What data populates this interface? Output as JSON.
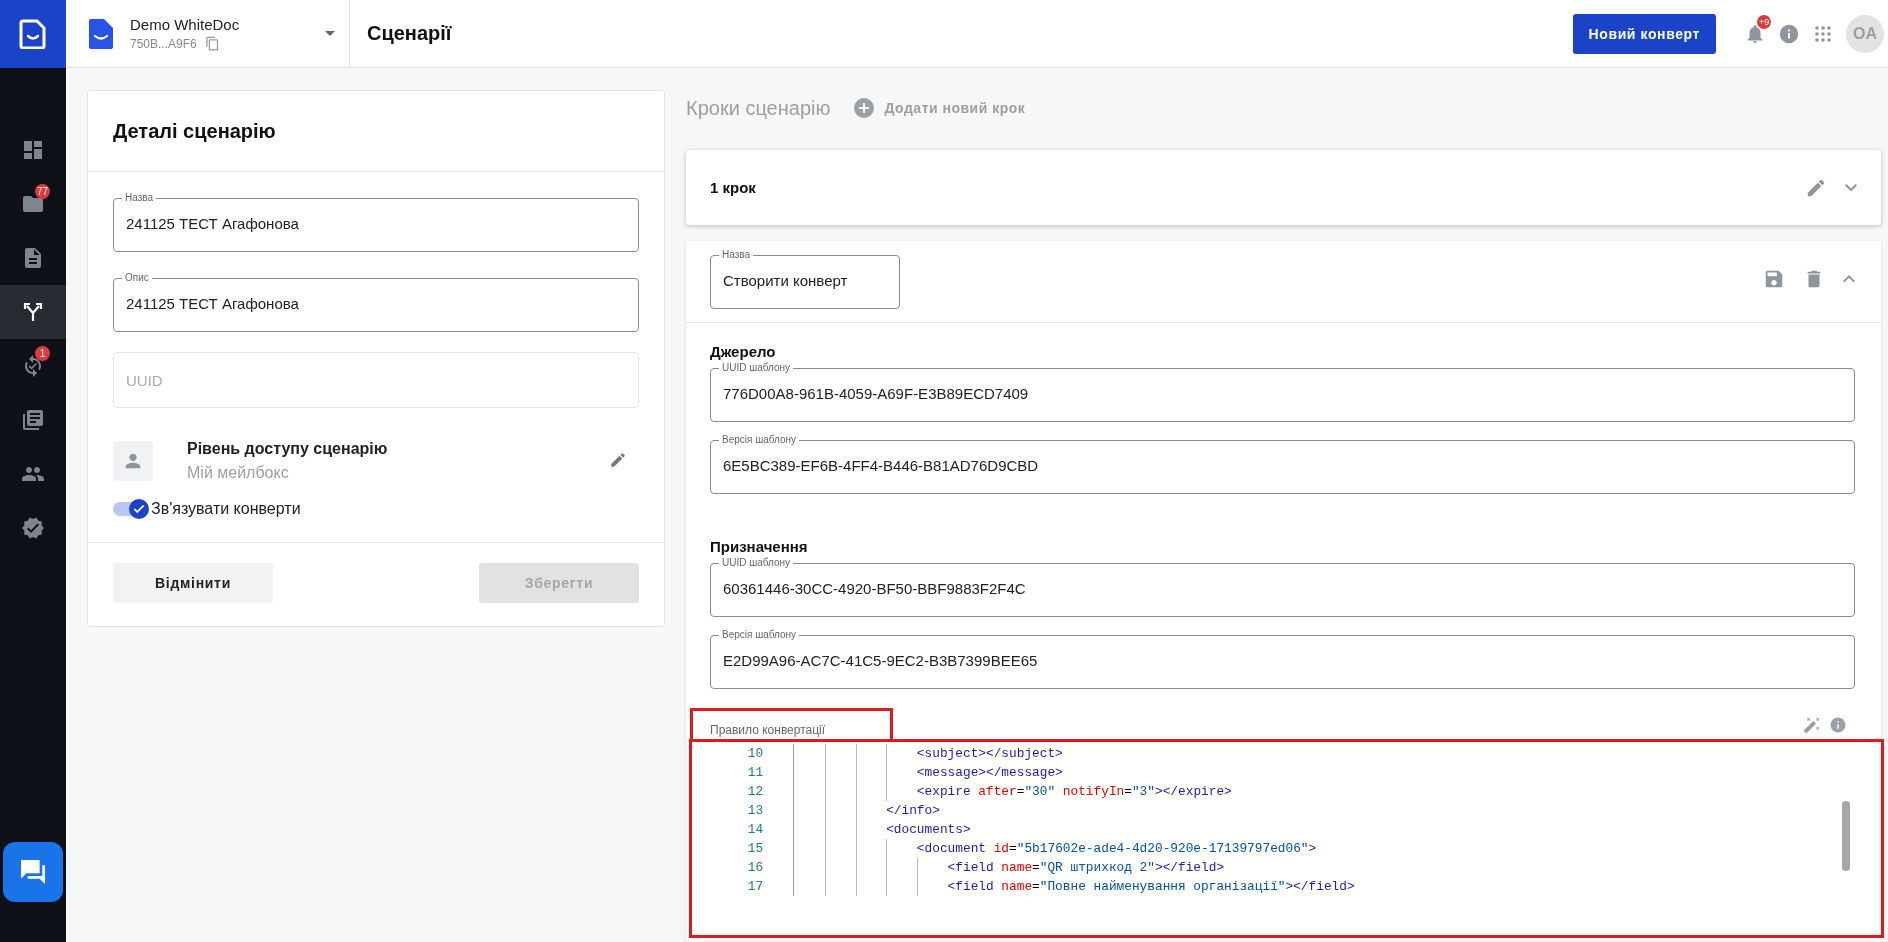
{
  "sidebar": {
    "items": [
      {
        "selected": false
      },
      {
        "selected": false,
        "badge": "77"
      },
      {
        "selected": false
      },
      {
        "selected": true
      },
      {
        "selected": false,
        "badge": "1"
      },
      {
        "selected": false
      },
      {
        "selected": false
      },
      {
        "selected": false
      }
    ]
  },
  "workspace": {
    "name": "Demo WhiteDoc",
    "id": "750B...A9F6"
  },
  "page_title": "Сценарії",
  "header": {
    "new_button": "Новий конверт",
    "notifications_badge": "+9",
    "avatar": "OA"
  },
  "details": {
    "title": "Деталі сценарію",
    "fields": [
      {
        "label": "Назва",
        "value": "241125 ТЕСТ Агафонова"
      },
      {
        "label": "Опис",
        "value": "241125 ТЕСТ Агафонова"
      },
      {
        "placeholder": "UUID"
      }
    ],
    "access": {
      "title": "Рівень доступу сценарію",
      "value": "Мій мейлбокс"
    },
    "link_toggle": {
      "label": "Зв'язувати конверти",
      "on": true
    },
    "buttons": [
      {
        "label": "Відмінити",
        "disabled": false
      },
      {
        "label": "Зберегти",
        "disabled": true
      }
    ]
  },
  "steps": {
    "title": "Кроки сценарію",
    "add_button": "Додати новий крок",
    "items": [
      {
        "title": "1 крок",
        "expanded": false
      },
      {
        "expanded": true,
        "name_label": "Назва",
        "name": "Створити конверт",
        "sections": [
          {
            "title": "Джерело",
            "fields": [
              {
                "label": "UUID шаблону",
                "value": "776D00A8-961B-4059-A69F-E3B89ECD7409"
              },
              {
                "label": "Версія шаблону",
                "value": "6E5BC389-EF6B-4FF4-B446-B81AD76D9CBD"
              }
            ]
          },
          {
            "title": "Призначення",
            "fields": [
              {
                "label": "UUID шаблону",
                "value": "60361446-30CC-4920-BF50-BBF9883F2F4C"
              },
              {
                "label": "Версія шаблону",
                "value": "E2D99A96-AC7C-41C5-9EC2-B3B7399BEE65"
              }
            ]
          }
        ],
        "rule": {
          "label": "Правило конвертації",
          "lines": [
            {
              "number": "10",
              "tokens": [
                {
                  "kind": "tag",
                  "text": "                <subject></subject>"
                }
              ]
            },
            {
              "number": "11",
              "tokens": [
                {
                  "kind": "tag",
                  "text": "                <message></message>"
                }
              ]
            },
            {
              "number": "12",
              "tokens": [
                {
                  "kind": "tag",
                  "text": "                <expire"
                },
                {
                  "kind": "attr",
                  "text": " after"
                },
                {
                  "kind": "punct",
                  "text": "="
                },
                {
                  "kind": "value",
                  "text": "\"30\""
                },
                {
                  "kind": "attr",
                  "text": " notifyIn"
                },
                {
                  "kind": "punct",
                  "text": "="
                },
                {
                  "kind": "value",
                  "text": "\"3\""
                },
                {
                  "kind": "tag",
                  "text": "></expire>"
                }
              ]
            },
            {
              "number": "13",
              "tokens": [
                {
                  "kind": "tag",
                  "text": "            </info>"
                }
              ]
            },
            {
              "number": "14",
              "tokens": [
                {
                  "kind": "tag",
                  "text": "            <documents>"
                }
              ]
            },
            {
              "number": "15",
              "tokens": [
                {
                  "kind": "tag",
                  "text": "                <document"
                },
                {
                  "kind": "attr",
                  "text": " id"
                },
                {
                  "kind": "punct",
                  "text": "="
                },
                {
                  "kind": "value",
                  "text": "\"5b17602e-ade4-4d20-920e-17139797ed06\""
                },
                {
                  "kind": "tag",
                  "text": ">"
                }
              ]
            },
            {
              "number": "16",
              "tokens": [
                {
                  "kind": "tag",
                  "text": "                    <field"
                },
                {
                  "kind": "attr",
                  "text": " name"
                },
                {
                  "kind": "punct",
                  "text": "="
                },
                {
                  "kind": "value",
                  "text": "\"QR штрихкод 2\""
                },
                {
                  "kind": "tag",
                  "text": "></field>"
                }
              ]
            },
            {
              "number": "17",
              "tokens": [
                {
                  "kind": "tag",
                  "text": "                    <field"
                },
                {
                  "kind": "attr",
                  "text": " name"
                },
                {
                  "kind": "punct",
                  "text": "="
                },
                {
                  "kind": "value",
                  "text": "\"Повне найменування організації\""
                },
                {
                  "kind": "tag",
                  "text": "></field>"
                }
              ]
            }
          ]
        }
      }
    ]
  }
}
